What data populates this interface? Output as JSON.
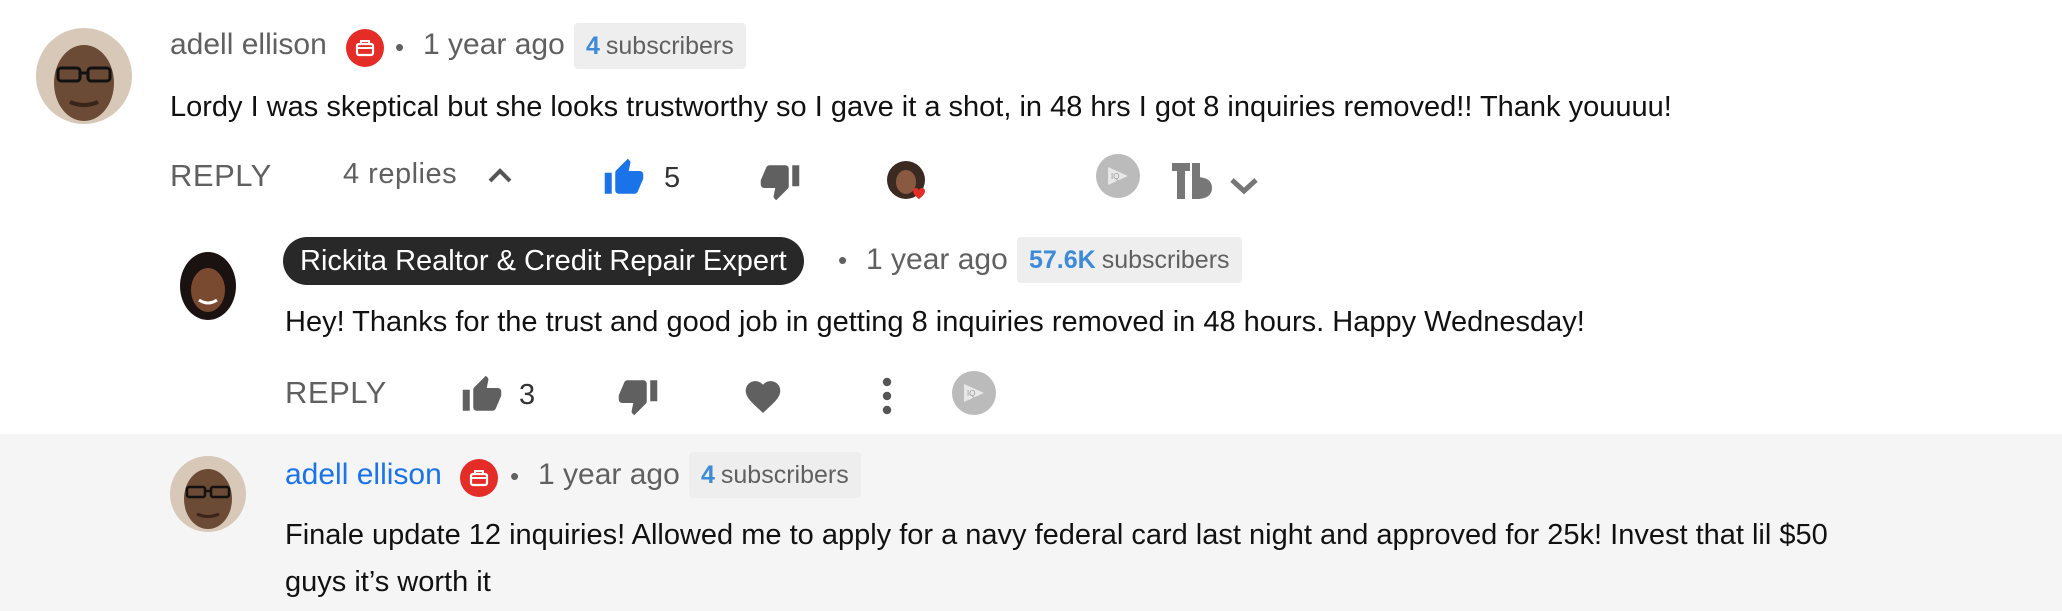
{
  "comments": [
    {
      "author": "adell ellison",
      "time": "1 year ago",
      "subscribers_count": "4",
      "subscribers_label": "subscribers",
      "text": "Lordy I was skeptical but she looks trustworthy so I gave it a shot, in 48 hrs I got 8 inquiries removed!! Thank youuuu!",
      "reply_label": "REPLY",
      "replies_label": "4 replies",
      "like_count": "5"
    }
  ],
  "replies": [
    {
      "author": "Rickita Realtor & Credit Repair Expert",
      "time": "1 year ago",
      "subscribers_count": "57.6K",
      "subscribers_label": "subscribers",
      "text": "Hey! Thanks for the trust and good job in getting 8 inquiries removed in 48 hours. Happy Wednesday!",
      "reply_label": "REPLY",
      "like_count": "3"
    },
    {
      "author": "adell ellison",
      "time": "1 year ago",
      "subscribers_count": "4",
      "subscribers_label": "subscribers",
      "text_line1": "Finale update 12 inquiries! Allowed me to apply for a navy federal card last night and approved for 25k! Invest that lil $50",
      "text_line2": "guys it’s worth it"
    }
  ],
  "separator": "•",
  "icons": {
    "badge": "membership-badge-icon",
    "like": "thumbs-up-icon",
    "dislike": "thumbs-down-icon",
    "heart": "heart-icon",
    "creator_heart": "creator-heart-icon",
    "more": "more-vert-icon",
    "chevron_up": "chevron-up-icon",
    "chevron_down": "chevron-down-icon",
    "extension_iq": "iq-extension-icon",
    "extension_tb": "tubebuddy-icon"
  },
  "colors": {
    "like_active": "#1a73e8",
    "author_link": "#1a73e8",
    "badge_red": "#e52d27",
    "subscriber_number": "#3c8ad8",
    "highlight_bg": "#f5f5f5"
  }
}
